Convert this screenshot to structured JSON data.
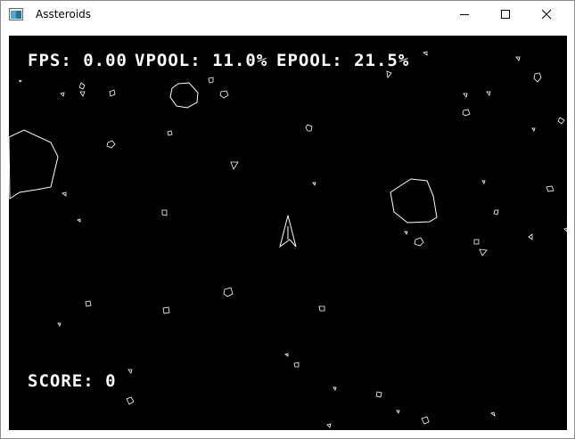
{
  "window": {
    "title": "Assteroids",
    "colors": {
      "titlebar": "#ffffff",
      "game_background": "#000000",
      "game_foreground": "#ffffff"
    },
    "icons": {
      "app": "app-window-icon",
      "minimize": "minimize-icon",
      "maximize": "maximize-icon",
      "close": "close-icon"
    }
  },
  "hud": {
    "fps": "FPS: 0.00",
    "vpool": "VPOOL: 11.0%",
    "epool": "EPOOL: 21.5%",
    "score": "SCORE: 0"
  }
}
